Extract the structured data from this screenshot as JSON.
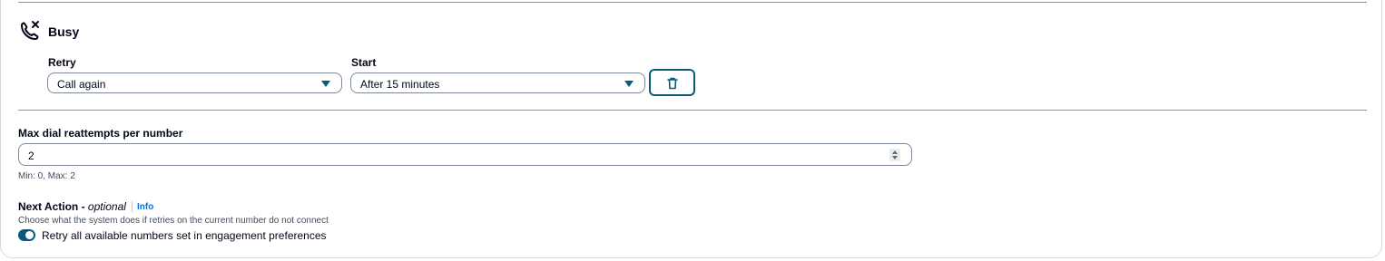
{
  "busy": {
    "title": "Busy",
    "icon": "phone-x-icon",
    "retry": {
      "label": "Retry",
      "value": "Call again"
    },
    "start": {
      "label": "Start",
      "value": "After 15 minutes"
    },
    "delete_icon": "trash-icon"
  },
  "max_dial": {
    "label": "Max dial reattempts per number",
    "value": "2",
    "constraint": "Min: 0, Max: 2"
  },
  "next_action": {
    "label": "Next Action -",
    "optional": "optional",
    "info": "Info",
    "description": "Choose what the system does if retries on the current number do not connect",
    "toggle_label": "Retry all available numbers set in engagement preferences",
    "toggle_on": true
  },
  "colors": {
    "accent": "#0972d3",
    "toggle": "#0b5a7a",
    "border": "#7d8998"
  }
}
